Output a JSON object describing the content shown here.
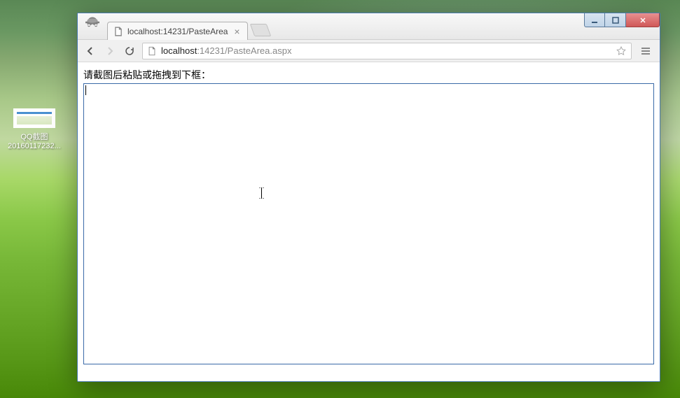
{
  "desktop": {
    "icon_label_1": "QQ截图",
    "icon_label_2": "20160117232..."
  },
  "browser": {
    "tab": {
      "title": "localhost:14231/PasteArea"
    },
    "url": {
      "host": "localhost",
      "rest": ":14231/PasteArea.aspx"
    },
    "window_controls": {
      "minimize": "—",
      "maximize": "▢",
      "close": "✕"
    }
  },
  "page": {
    "instruction": "请截图后粘贴或拖拽到下框："
  }
}
